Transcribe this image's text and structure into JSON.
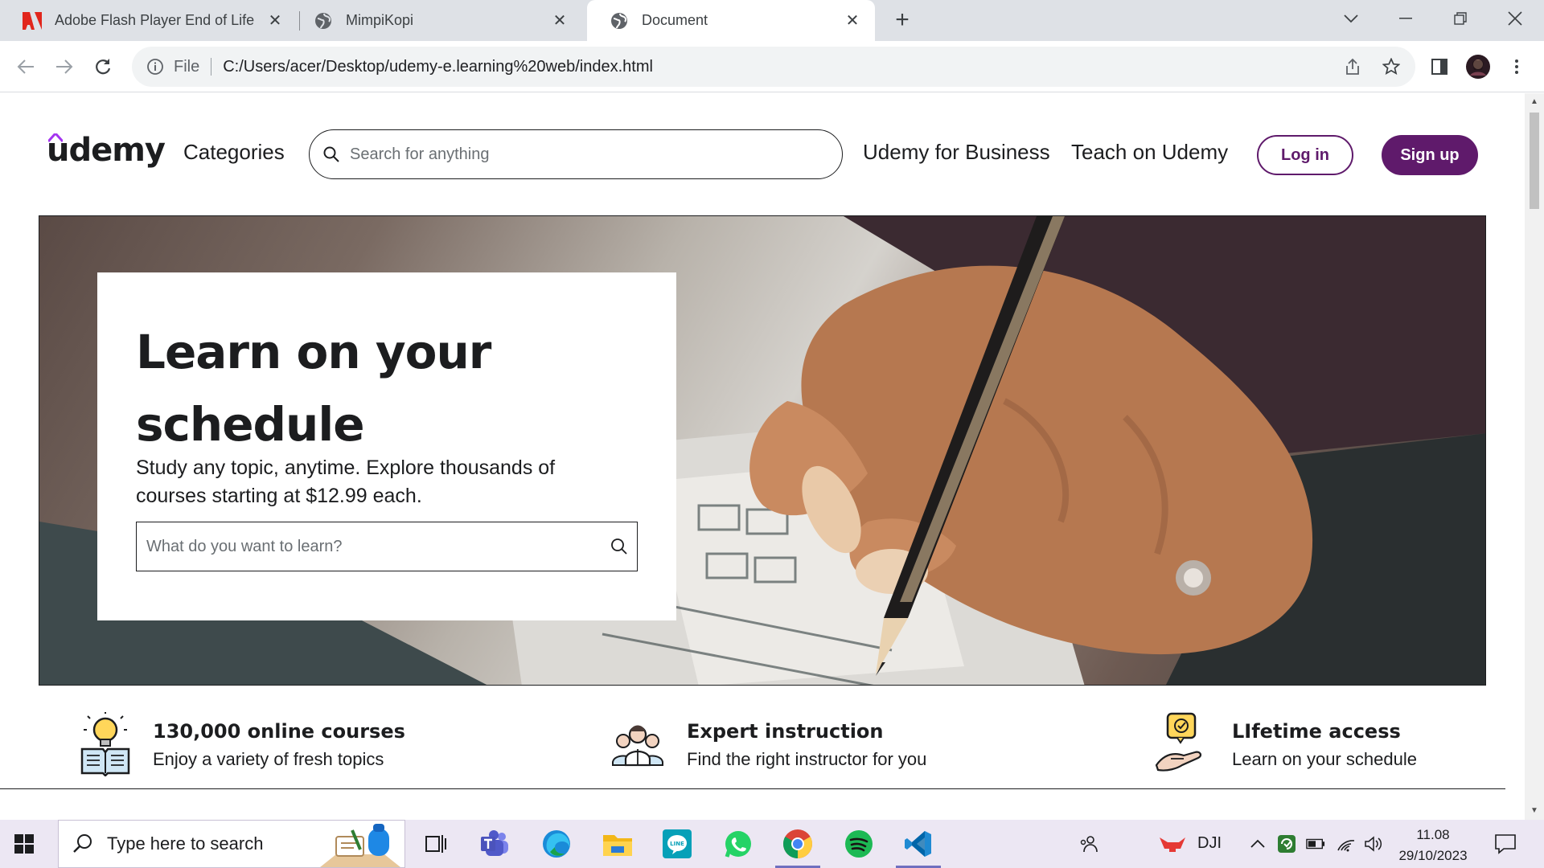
{
  "browser": {
    "tabs": [
      {
        "title": "Adobe Flash Player End of Life",
        "icon": "adobe-icon",
        "active": false
      },
      {
        "title": "MimpiKopi",
        "icon": "globe-icon",
        "active": false
      },
      {
        "title": "Document",
        "icon": "globe-icon",
        "active": true
      }
    ],
    "scheme_label": "File",
    "url": "C:/Users/acer/Desktop/udemy-e.learning%20web/index.html"
  },
  "header": {
    "logo": "udemy",
    "categories": "Categories",
    "search_placeholder": "Search for anything",
    "business_link": "Udemy for Business",
    "teach_link": "Teach on Udemy",
    "login": "Log in",
    "signup": "Sign up"
  },
  "hero": {
    "title_line1": "Learn on your",
    "title_line2": "schedule",
    "subtitle": "Study any topic, anytime. Explore thousands of courses starting at $12.99 each.",
    "search_placeholder": "What do you want to learn?"
  },
  "features": [
    {
      "icon": "lightbulb-book-icon",
      "title": "130,000 online courses",
      "desc": "Enjoy a variety of fresh topics"
    },
    {
      "icon": "instructors-group-icon",
      "title": "Expert instruction",
      "desc": "Find the right instructor for you"
    },
    {
      "icon": "hand-checkmark-icon",
      "title": "LIfetime access",
      "desc": "Learn on your schedule"
    }
  ],
  "taskbar": {
    "search_text": "Type here to search",
    "tray_app_label": "DJI",
    "time": "11.08",
    "date": "29/10/2023"
  },
  "colors": {
    "brand_purple": "#5f1a6b",
    "logo_accent": "#a435f0"
  }
}
